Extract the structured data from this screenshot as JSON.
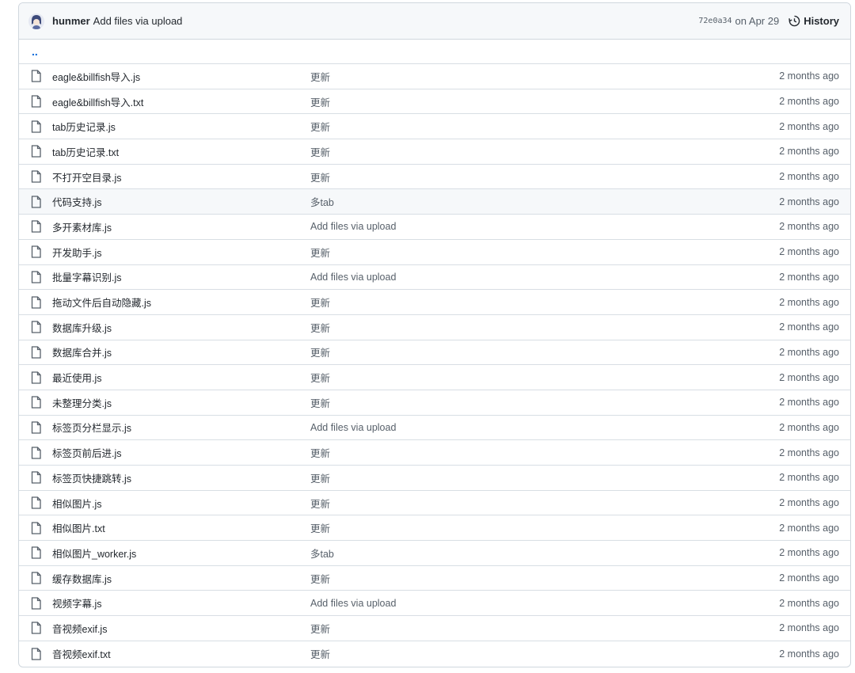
{
  "commit": {
    "author": "hunmer",
    "message": "Add files via upload",
    "sha": "72e0a34",
    "date": "on Apr 29",
    "history_label": "History"
  },
  "parent_dir": "..",
  "files": [
    {
      "name": "eagle&billfish导入.js",
      "message": "更新",
      "age": "2 months ago"
    },
    {
      "name": "eagle&billfish导入.txt",
      "message": "更新",
      "age": "2 months ago"
    },
    {
      "name": "tab历史记录.js",
      "message": "更新",
      "age": "2 months ago"
    },
    {
      "name": "tab历史记录.txt",
      "message": "更新",
      "age": "2 months ago"
    },
    {
      "name": "不打开空目录.js",
      "message": "更新",
      "age": "2 months ago"
    },
    {
      "name": "代码支持.js",
      "message": "多tab",
      "age": "2 months ago",
      "highlighted": true
    },
    {
      "name": "多开素材库.js",
      "message": "Add files via upload",
      "age": "2 months ago"
    },
    {
      "name": "开发助手.js",
      "message": "更新",
      "age": "2 months ago"
    },
    {
      "name": "批量字幕识别.js",
      "message": "Add files via upload",
      "age": "2 months ago"
    },
    {
      "name": "拖动文件后自动隐藏.js",
      "message": "更新",
      "age": "2 months ago"
    },
    {
      "name": "数据库升级.js",
      "message": "更新",
      "age": "2 months ago"
    },
    {
      "name": "数据库合并.js",
      "message": "更新",
      "age": "2 months ago"
    },
    {
      "name": "最近使用.js",
      "message": "更新",
      "age": "2 months ago"
    },
    {
      "name": "未整理分类.js",
      "message": "更新",
      "age": "2 months ago"
    },
    {
      "name": "标签页分栏显示.js",
      "message": "Add files via upload",
      "age": "2 months ago"
    },
    {
      "name": "标签页前后进.js",
      "message": "更新",
      "age": "2 months ago"
    },
    {
      "name": "标签页快捷跳转.js",
      "message": "更新",
      "age": "2 months ago"
    },
    {
      "name": "相似图片.js",
      "message": "更新",
      "age": "2 months ago"
    },
    {
      "name": "相似图片.txt",
      "message": "更新",
      "age": "2 months ago"
    },
    {
      "name": "相似图片_worker.js",
      "message": "多tab",
      "age": "2 months ago"
    },
    {
      "name": "缓存数据库.js",
      "message": "更新",
      "age": "2 months ago"
    },
    {
      "name": "视频字幕.js",
      "message": "Add files via upload",
      "age": "2 months ago"
    },
    {
      "name": "音视频exif.js",
      "message": "更新",
      "age": "2 months ago"
    },
    {
      "name": "音视频exif.txt",
      "message": "更新",
      "age": "2 months ago"
    }
  ],
  "icons": {
    "file": "file-icon",
    "history": "history-icon",
    "avatar": "avatar-icon"
  },
  "colors": {
    "link": "#0969da",
    "muted": "#57606a",
    "border": "#d0d7de"
  }
}
